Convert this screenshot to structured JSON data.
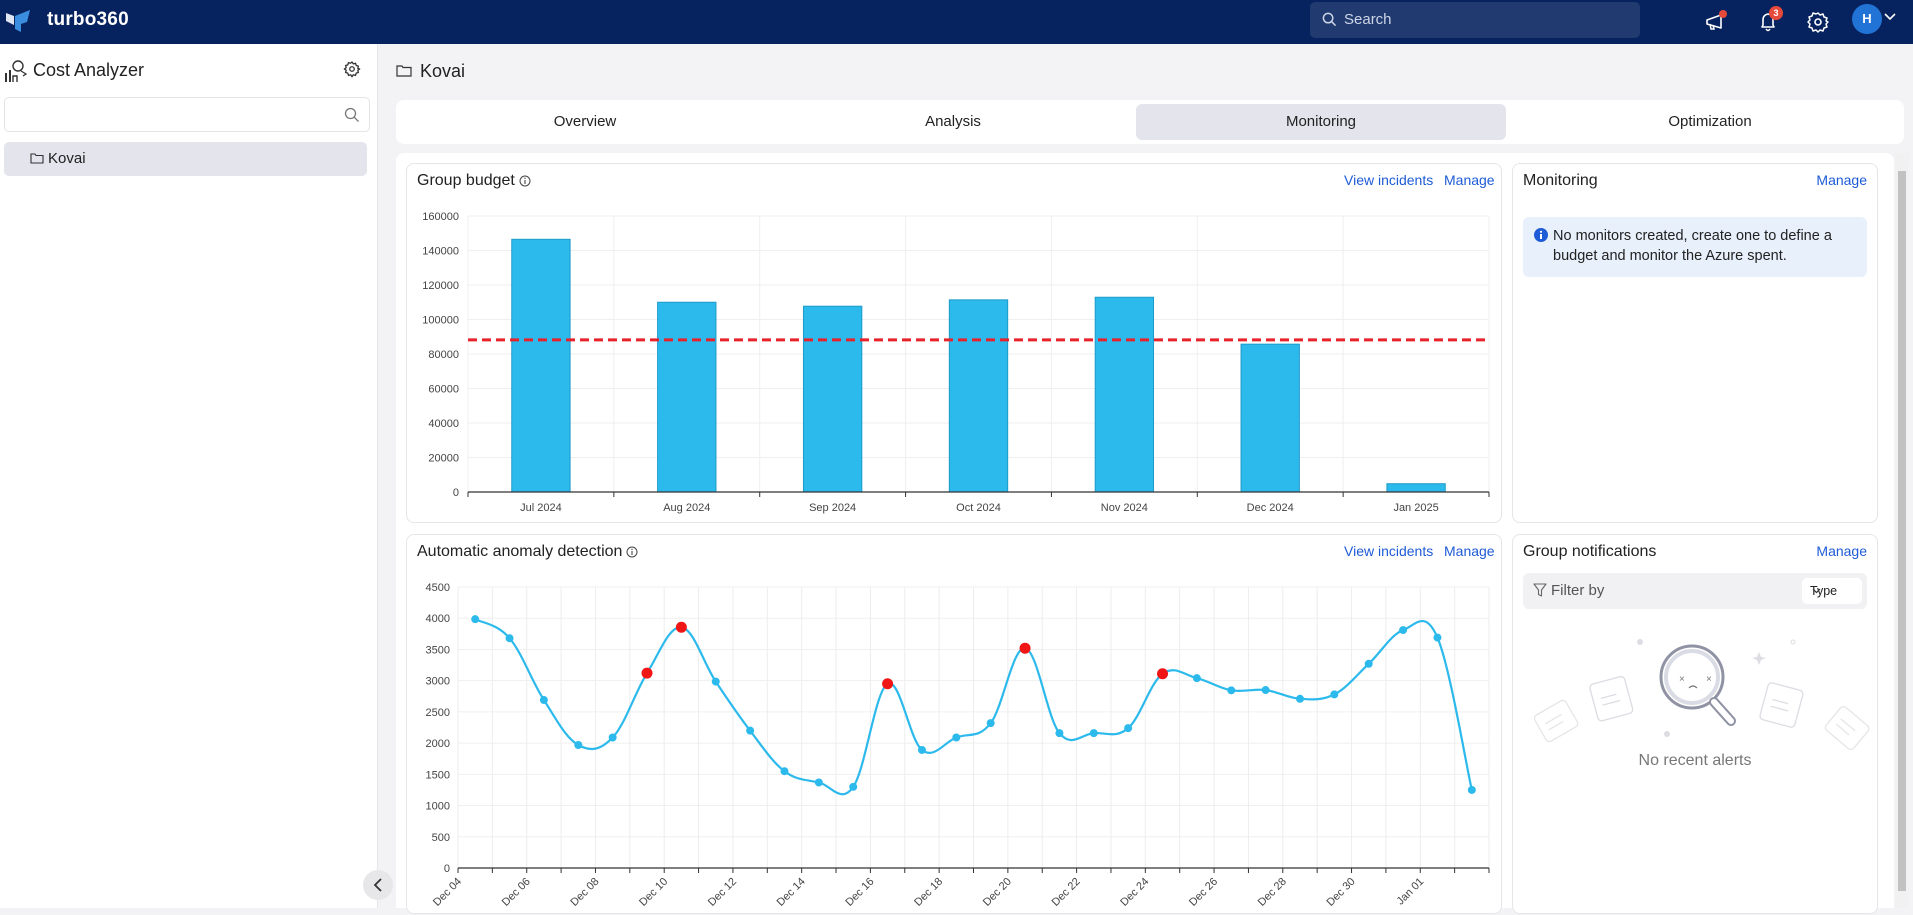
{
  "app": {
    "brand": "turbo360",
    "search_placeholder": "Search",
    "notification_count": "3",
    "user_initial": "H"
  },
  "sidebar": {
    "title": "Cost Analyzer",
    "search_value": "",
    "items": [
      {
        "label": "Kovai",
        "icon": "folder-icon",
        "selected": true
      }
    ]
  },
  "breadcrumb": {
    "label": "Kovai"
  },
  "tabs": [
    {
      "label": "Overview",
      "active": false
    },
    {
      "label": "Analysis",
      "active": false
    },
    {
      "label": "Monitoring",
      "active": true
    },
    {
      "label": "Optimization",
      "active": false
    }
  ],
  "group_budget": {
    "title": "Group budget",
    "view_incidents": "View incidents",
    "manage": "Manage"
  },
  "monitoring": {
    "title": "Monitoring",
    "manage": "Manage",
    "message": "No monitors created, create one to define a budget and monitor the Azure spent."
  },
  "anomaly": {
    "title": "Automatic anomaly detection",
    "view_incidents": "View incidents",
    "manage": "Manage"
  },
  "notifications": {
    "title": "Group notifications",
    "manage": "Manage",
    "filter_label": "Filter by",
    "type_select": "Type",
    "empty_message": "No recent alerts"
  },
  "colors": {
    "bar": "#2cb9ec",
    "budget_line": "#e8222a",
    "line": "#2cb9ec",
    "anomaly_point": "#f01616",
    "link": "#1e5bd6",
    "topbar": "#07235f"
  },
  "chart_data": [
    {
      "type": "bar",
      "title": "Group budget",
      "categories": [
        "Jul 2024",
        "Aug 2024",
        "Sep 2024",
        "Oct 2024",
        "Nov 2024",
        "Dec 2024",
        "Jan 2025"
      ],
      "values": [
        146500,
        110000,
        107700,
        111400,
        112900,
        85700,
        4800
      ],
      "budget_line": 88200,
      "ylim": [
        0,
        160000
      ],
      "yticks": [
        0,
        20000,
        40000,
        60000,
        80000,
        100000,
        120000,
        140000,
        160000
      ],
      "grid": true,
      "xlabel": "",
      "ylabel": ""
    },
    {
      "type": "line",
      "title": "Automatic anomaly detection",
      "categories": [
        "Dec 04",
        "Dec 05",
        "Dec 06",
        "Dec 07",
        "Dec 08",
        "Dec 09",
        "Dec 10",
        "Dec 11",
        "Dec 12",
        "Dec 13",
        "Dec 14",
        "Dec 15",
        "Dec 16",
        "Dec 17",
        "Dec 18",
        "Dec 19",
        "Dec 20",
        "Dec 21",
        "Dec 22",
        "Dec 23",
        "Dec 24",
        "Dec 25",
        "Dec 26",
        "Dec 27",
        "Dec 28",
        "Dec 29",
        "Dec 30",
        "Dec 31",
        "Jan 01",
        "Jan 02"
      ],
      "xtick_labels": [
        "Dec 04",
        "Dec 06",
        "Dec 08",
        "Dec 10",
        "Dec 12",
        "Dec 14",
        "Dec 16",
        "Dec 18",
        "Dec 20",
        "Dec 22",
        "Dec 24",
        "Dec 26",
        "Dec 28",
        "Dec 30",
        "Jan 01"
      ],
      "values": [
        3985,
        3680,
        2690,
        1970,
        2090,
        3120,
        3855,
        2985,
        2200,
        1550,
        1370,
        1300,
        2950,
        1890,
        2090,
        2320,
        3520,
        2160,
        2160,
        2240,
        3110,
        3040,
        2845,
        2850,
        2710,
        2780,
        3270,
        3810,
        3690,
        1250
      ],
      "anomalies": [
        "Dec 09",
        "Dec 10",
        "Dec 16",
        "Dec 20",
        "Dec 24"
      ],
      "ylim": [
        0,
        4500
      ],
      "yticks": [
        0,
        500,
        1000,
        1500,
        2000,
        2500,
        3000,
        3500,
        4000,
        4500
      ],
      "grid": true,
      "xlabel": "",
      "ylabel": ""
    }
  ]
}
